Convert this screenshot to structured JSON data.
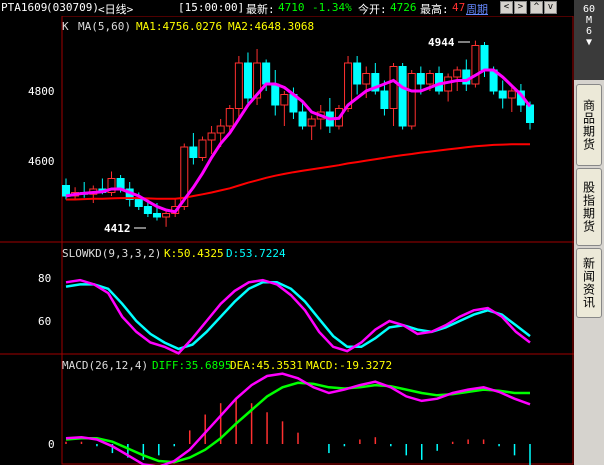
{
  "header": {
    "symbol": "PTA1609",
    "code": "(030709)",
    "period": "<日线>",
    "time": "[15:00:00]",
    "latest_label": "最新:",
    "latest": "4710",
    "change": "-1.34%",
    "open_label": "今开:",
    "open": "4726",
    "high_label": "最高:",
    "high": "47",
    "history_link": "周期"
  },
  "nav": {
    "btn_left": "<",
    "btn_right": ">",
    "btn_up": "^",
    "btn_down": "v"
  },
  "sidebar": {
    "top_label": "60\nM\n6\n▼",
    "tabs": [
      {
        "label": "商品期货"
      },
      {
        "label": "股指期货"
      },
      {
        "label": "新闻资讯"
      }
    ]
  },
  "main_panel": {
    "label_k": "K",
    "label_ma": "MA(5,60)",
    "ma1": "MA1:4756.0276",
    "ma2": "MA2:4648.3068",
    "yticks": [
      "4800",
      "4600"
    ],
    "annotation_high": "4944",
    "annotation_low": "4412"
  },
  "kd_panel": {
    "label": "SLOWKD(9,3,3,2)",
    "k": "K:50.4325",
    "d": "D:53.7224",
    "yticks": [
      "80",
      "60"
    ]
  },
  "macd_panel": {
    "label": "MACD(26,12,4)",
    "diff": "DIFF:35.6895",
    "dea": "DEA:45.3531",
    "macd": "MACD:-19.3272",
    "yticks": [
      "0"
    ]
  },
  "colors": {
    "up": "#ff3030",
    "down": "#00ffff",
    "ma_short": "#ff00ff",
    "ma_long": "#ff0000",
    "label_yellow": "#ffff00",
    "green": "#00ff00"
  },
  "chart_data": {
    "type": "candlestick",
    "candles": [
      [
        4530,
        4550,
        4490,
        4500
      ],
      [
        4500,
        4525,
        4490,
        4510
      ],
      [
        4510,
        4540,
        4495,
        4505
      ],
      [
        4505,
        4530,
        4480,
        4520
      ],
      [
        4520,
        4550,
        4505,
        4510
      ],
      [
        4510,
        4570,
        4500,
        4550
      ],
      [
        4550,
        4560,
        4510,
        4520
      ],
      [
        4520,
        4540,
        4470,
        4490
      ],
      [
        4490,
        4510,
        4460,
        4470
      ],
      [
        4470,
        4490,
        4440,
        4450
      ],
      [
        4450,
        4480,
        4430,
        4440
      ],
      [
        4440,
        4460,
        4412,
        4450
      ],
      [
        4450,
        4490,
        4440,
        4470
      ],
      [
        4470,
        4650,
        4460,
        4640
      ],
      [
        4640,
        4680,
        4590,
        4610
      ],
      [
        4610,
        4670,
        4600,
        4660
      ],
      [
        4660,
        4700,
        4620,
        4680
      ],
      [
        4680,
        4720,
        4640,
        4700
      ],
      [
        4700,
        4760,
        4680,
        4750
      ],
      [
        4750,
        4900,
        4720,
        4880
      ],
      [
        4880,
        4910,
        4760,
        4780
      ],
      [
        4780,
        4920,
        4760,
        4880
      ],
      [
        4880,
        4890,
        4800,
        4820
      ],
      [
        4820,
        4860,
        4730,
        4760
      ],
      [
        4760,
        4800,
        4700,
        4790
      ],
      [
        4790,
        4810,
        4720,
        4740
      ],
      [
        4740,
        4770,
        4690,
        4700
      ],
      [
        4700,
        4730,
        4660,
        4720
      ],
      [
        4720,
        4760,
        4690,
        4740
      ],
      [
        4740,
        4780,
        4680,
        4700
      ],
      [
        4700,
        4760,
        4690,
        4750
      ],
      [
        4750,
        4900,
        4740,
        4880
      ],
      [
        4880,
        4900,
        4790,
        4820
      ],
      [
        4820,
        4870,
        4780,
        4850
      ],
      [
        4850,
        4880,
        4790,
        4800
      ],
      [
        4800,
        4830,
        4730,
        4750
      ],
      [
        4750,
        4880,
        4700,
        4870
      ],
      [
        4870,
        4880,
        4690,
        4700
      ],
      [
        4700,
        4860,
        4690,
        4850
      ],
      [
        4850,
        4870,
        4790,
        4820
      ],
      [
        4820,
        4860,
        4800,
        4850
      ],
      [
        4850,
        4870,
        4790,
        4800
      ],
      [
        4800,
        4850,
        4770,
        4840
      ],
      [
        4840,
        4870,
        4800,
        4860
      ],
      [
        4860,
        4890,
        4800,
        4820
      ],
      [
        4820,
        4944,
        4810,
        4930
      ],
      [
        4930,
        4940,
        4840,
        4860
      ],
      [
        4860,
        4870,
        4790,
        4800
      ],
      [
        4800,
        4830,
        4750,
        4780
      ],
      [
        4780,
        4810,
        4740,
        4800
      ],
      [
        4800,
        4820,
        4740,
        4760
      ],
      [
        4760,
        4770,
        4690,
        4710
      ]
    ],
    "ma5": [
      4500,
      4505,
      4508,
      4510,
      4512,
      4520,
      4520,
      4510,
      4500,
      4485,
      4470,
      4460,
      4455,
      4490,
      4525,
      4565,
      4610,
      4650,
      4680,
      4720,
      4760,
      4790,
      4820,
      4820,
      4810,
      4790,
      4770,
      4740,
      4730,
      4720,
      4722,
      4760,
      4780,
      4800,
      4810,
      4820,
      4830,
      4810,
      4800,
      4800,
      4810,
      4820,
      4825,
      4830,
      4830,
      4845,
      4860,
      4860,
      4840,
      4815,
      4790,
      4756
    ],
    "ma60": [
      4490,
      4490,
      4491,
      4492,
      4492,
      4493,
      4494,
      4494,
      4494,
      4493,
      4492,
      4492,
      4492,
      4495,
      4500,
      4505,
      4510,
      4516,
      4522,
      4530,
      4538,
      4545,
      4552,
      4558,
      4563,
      4568,
      4572,
      4576,
      4580,
      4584,
      4588,
      4593,
      4597,
      4601,
      4605,
      4609,
      4613,
      4617,
      4620,
      4624,
      4627,
      4630,
      4633,
      4636,
      4639,
      4642,
      4644,
      4646,
      4647,
      4648,
      4648,
      4648
    ],
    "k": [
      78,
      79,
      77,
      73,
      62,
      55,
      50,
      48,
      45,
      52,
      60,
      68,
      74,
      78,
      79,
      77,
      72,
      65,
      55,
      48,
      46,
      50,
      56,
      60,
      58,
      54,
      55,
      58,
      62,
      65,
      66,
      62,
      55,
      50
    ],
    "d": [
      76,
      77,
      77,
      75,
      68,
      60,
      54,
      50,
      47,
      49,
      55,
      62,
      69,
      75,
      78,
      78,
      75,
      69,
      61,
      53,
      48,
      48,
      52,
      57,
      58,
      56,
      55,
      57,
      60,
      63,
      65,
      63,
      58,
      53
    ],
    "diff": [
      5,
      6,
      4,
      -2,
      -10,
      -18,
      -20,
      -15,
      -5,
      10,
      25,
      40,
      52,
      60,
      62,
      58,
      50,
      45,
      48,
      52,
      55,
      50,
      42,
      38,
      40,
      45,
      48,
      50,
      46,
      40,
      35
    ],
    "dea": [
      4,
      5,
      5,
      2,
      -4,
      -10,
      -15,
      -16,
      -12,
      -5,
      5,
      18,
      30,
      42,
      50,
      54,
      53,
      50,
      49,
      50,
      52,
      51,
      48,
      45,
      43,
      44,
      46,
      48,
      47,
      45,
      45
    ],
    "macd": [
      2,
      2,
      -2,
      -8,
      -12,
      -14,
      -10,
      -2,
      12,
      26,
      36,
      40,
      36,
      28,
      20,
      10,
      0,
      -8,
      -2,
      4,
      6,
      -2,
      -10,
      -14,
      -6,
      2,
      4,
      4,
      -2,
      -10,
      -19
    ]
  }
}
